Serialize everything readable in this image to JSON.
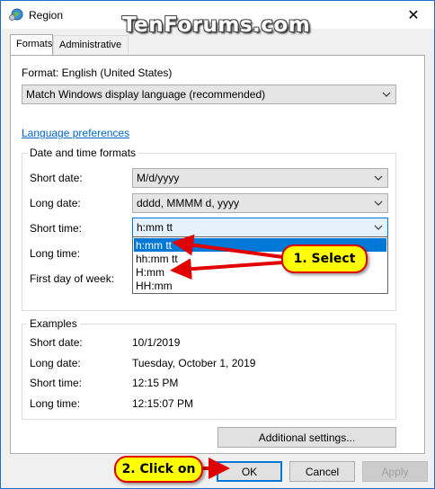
{
  "window": {
    "title": "Region",
    "close_symbol": "✕"
  },
  "watermark": "TenForums.com",
  "tabs": [
    {
      "label": "Formats",
      "active": true
    },
    {
      "label": "Administrative",
      "active": false
    }
  ],
  "format": {
    "label": "Format: English (United States)",
    "value": "Match Windows display language (recommended)"
  },
  "language_link": "Language preferences",
  "datetime": {
    "group_title": "Date and time formats",
    "short_date": {
      "label": "Short date:",
      "value": "M/d/yyyy"
    },
    "long_date": {
      "label": "Long date:",
      "value": "dddd, MMMM d, yyyy"
    },
    "short_time": {
      "label": "Short time:",
      "value": "h:mm tt"
    },
    "long_time": {
      "label": "Long time:"
    },
    "first_day": {
      "label": "First day of week:"
    }
  },
  "dropdown": {
    "options": [
      "h:mm tt",
      "hh:mm tt",
      "H:mm",
      "HH:mm"
    ],
    "selected_index": 0
  },
  "examples": {
    "group_title": "Examples",
    "rows": [
      {
        "label": "Short date:",
        "value": "10/1/2019"
      },
      {
        "label": "Long date:",
        "value": "Tuesday, October 1, 2019"
      },
      {
        "label": "Short time:",
        "value": "12:15 PM"
      },
      {
        "label": "Long time:",
        "value": "12:15:07 PM"
      }
    ]
  },
  "buttons": {
    "additional": "Additional settings...",
    "ok": "OK",
    "cancel": "Cancel",
    "apply": "Apply"
  },
  "callouts": {
    "select": "1. Select",
    "click": "2. Click on"
  },
  "colors": {
    "accent": "#0078d7",
    "link": "#0066cc",
    "callout_fill": "#ffff00",
    "callout_border": "#e00000",
    "arrow": "#e00000"
  }
}
